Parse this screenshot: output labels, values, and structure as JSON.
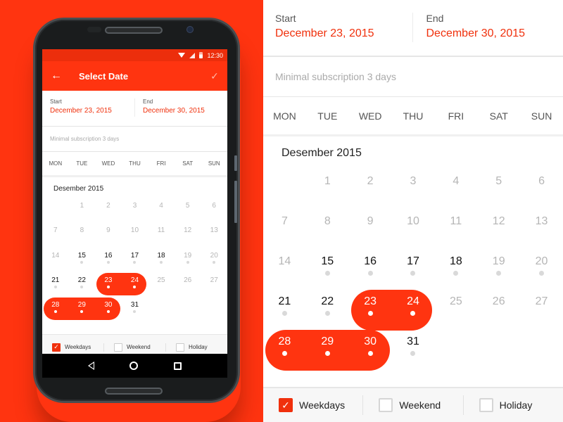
{
  "colors": {
    "accent": "#ff3410",
    "accent_text": "#f0300c",
    "muted_day": "#b5b5b5",
    "active_day": "#111111",
    "dot": "#d9d9d9"
  },
  "phone": {
    "status_bar": {
      "time": "12:30",
      "icons": [
        "wifi-icon",
        "signal-icon",
        "battery-icon"
      ]
    },
    "app_bar": {
      "back_icon": "←",
      "title": "Select Date",
      "confirm_icon": "✓"
    },
    "nav_bar": {
      "buttons": [
        "back",
        "home",
        "recents"
      ]
    }
  },
  "range": {
    "start_label": "Start",
    "start_value": "December 23, 2015",
    "end_label": "End",
    "end_value": "December 30, 2015"
  },
  "notice": "Minimal subscription 3 days",
  "weekdays": [
    "MON",
    "TUE",
    "WED",
    "THU",
    "FRI",
    "SAT",
    "SUN"
  ],
  "month_title": "Desember 2015",
  "first_weekday_offset": 1,
  "days": [
    {
      "d": 1,
      "state": "disabled"
    },
    {
      "d": 2,
      "state": "disabled"
    },
    {
      "d": 3,
      "state": "disabled"
    },
    {
      "d": 4,
      "state": "disabled"
    },
    {
      "d": 5,
      "state": "disabled"
    },
    {
      "d": 6,
      "state": "disabled"
    },
    {
      "d": 7,
      "state": "disabled"
    },
    {
      "d": 8,
      "state": "disabled"
    },
    {
      "d": 9,
      "state": "disabled"
    },
    {
      "d": 10,
      "state": "disabled"
    },
    {
      "d": 11,
      "state": "disabled"
    },
    {
      "d": 12,
      "state": "disabled"
    },
    {
      "d": 13,
      "state": "disabled"
    },
    {
      "d": 14,
      "state": "disabled"
    },
    {
      "d": 15,
      "state": "available"
    },
    {
      "d": 16,
      "state": "available"
    },
    {
      "d": 17,
      "state": "available"
    },
    {
      "d": 18,
      "state": "available"
    },
    {
      "d": 19,
      "state": "weekend"
    },
    {
      "d": 20,
      "state": "weekend"
    },
    {
      "d": 21,
      "state": "available"
    },
    {
      "d": 22,
      "state": "available"
    },
    {
      "d": 23,
      "state": "selected"
    },
    {
      "d": 24,
      "state": "selected"
    },
    {
      "d": 25,
      "state": "holiday"
    },
    {
      "d": 26,
      "state": "holiday"
    },
    {
      "d": 27,
      "state": "holiday"
    },
    {
      "d": 28,
      "state": "selected"
    },
    {
      "d": 29,
      "state": "selected"
    },
    {
      "d": 30,
      "state": "selected"
    },
    {
      "d": 31,
      "state": "available"
    }
  ],
  "selected_ranges": [
    [
      23,
      24
    ],
    [
      28,
      30
    ]
  ],
  "filters": [
    {
      "label": "Weekdays",
      "checked": true
    },
    {
      "label": "Weekend",
      "checked": false
    },
    {
      "label": "Holiday",
      "checked": false
    }
  ]
}
